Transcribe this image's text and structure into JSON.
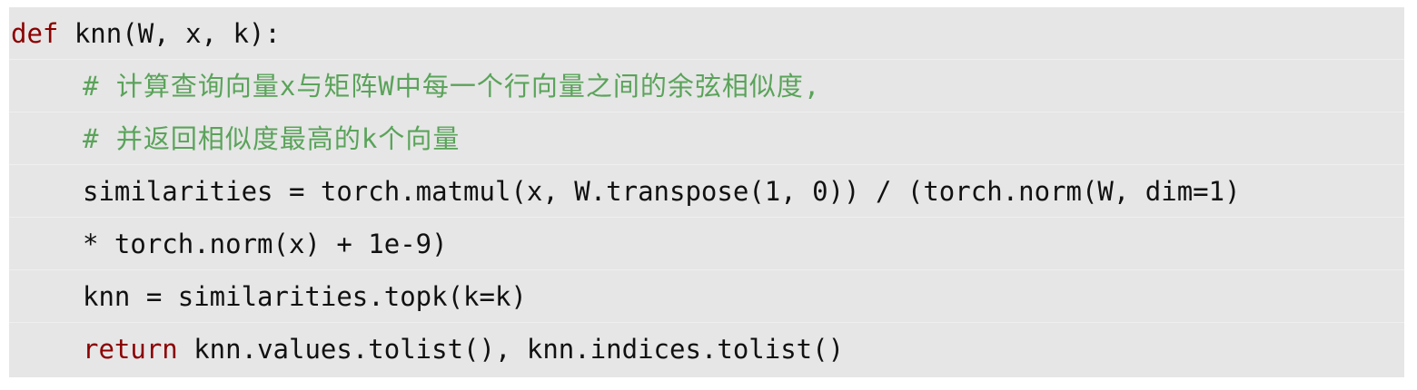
{
  "code": {
    "line1": {
      "keyword": "def",
      "rest": " knn(W, x, k):"
    },
    "line2": {
      "comment": "# 计算查询向量x与矩阵W中每一个行向量之间的余弦相似度,"
    },
    "line3": {
      "comment": "# 并返回相似度最高的k个向量"
    },
    "line4": {
      "text": "similarities = torch.matmul(x, W.transpose(1, 0)) / (torch.norm(W, dim=1)"
    },
    "line5": {
      "text": "* torch.norm(x) + 1e-9)"
    },
    "line6": {
      "text": "knn = similarities.topk(k=k)"
    },
    "line7": {
      "keyword": "return",
      "rest": " knn.values.tolist(), knn.indices.tolist()"
    }
  },
  "colors": {
    "background": "#e6e6e6",
    "keyword": "#8b0000",
    "comment": "#5aa35a",
    "text": "#111111"
  }
}
